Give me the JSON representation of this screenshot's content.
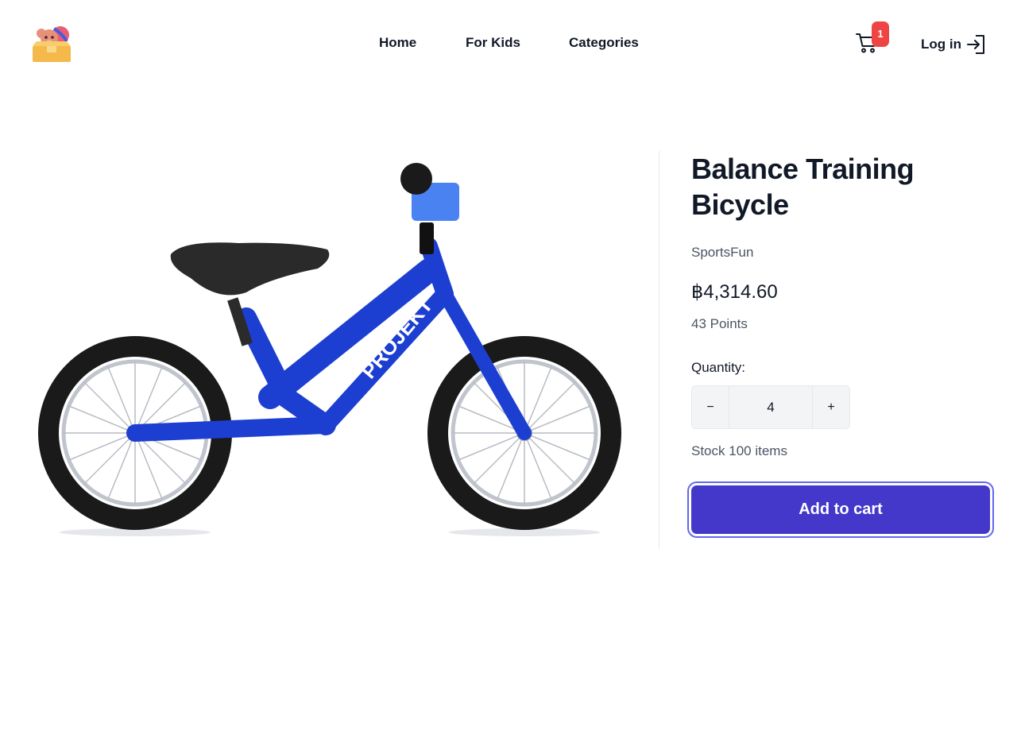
{
  "nav": {
    "home": "Home",
    "for_kids": "For Kids",
    "categories": "Categories"
  },
  "cart": {
    "count": "1",
    "icon": "cart-icon"
  },
  "login": {
    "label": "Log in",
    "icon": "login-icon"
  },
  "product": {
    "title_line1": "Balance Training",
    "title_line2": "Bicycle",
    "brand": "SportsFun",
    "price": "฿4,314.60",
    "points": "43 Points",
    "quantity_label": "Quantity:",
    "quantity": "4",
    "decrement": "−",
    "increment": "+",
    "stock": "Stock 100 items",
    "add_to_cart": "Add to cart",
    "image_text": "PROJEKT"
  },
  "colors": {
    "accent": "#4338ca",
    "badge": "#ef4444",
    "bike": "#1d3fd1"
  }
}
